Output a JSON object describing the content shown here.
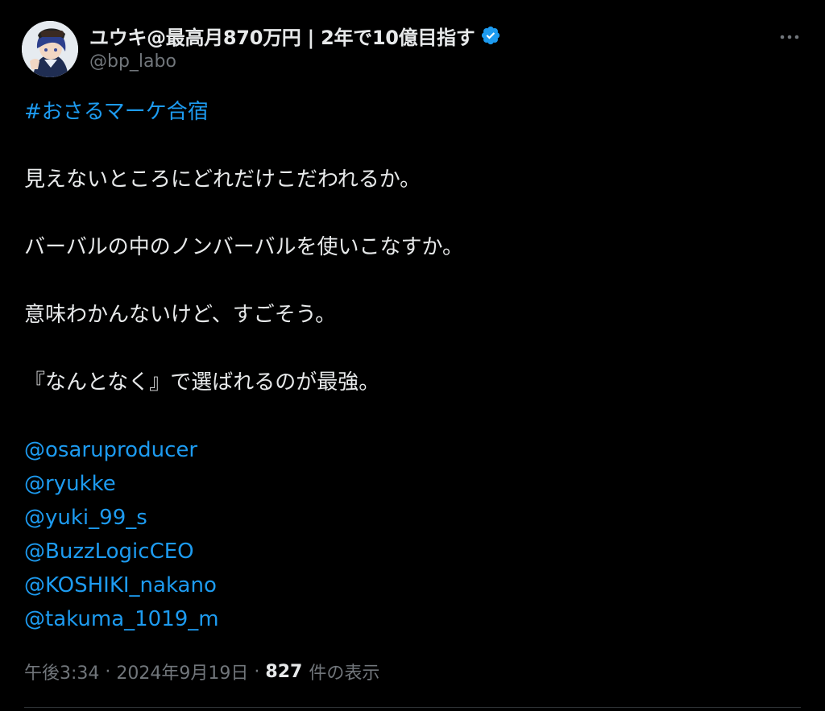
{
  "author": {
    "display_name": "ユウキ@最高月870万円 | 2年で10億目指す",
    "handle": "@bp_labo",
    "verified": true
  },
  "tweet": {
    "hashtag": "#おさるマーケ合宿",
    "lines": [
      "見えないところにどれだけこだわれるか。",
      "バーバルの中のノンバーバルを使いこなすか。",
      "意味わかんないけど、すごそう。",
      "『なんとなく』で選ばれるのが最強。"
    ],
    "mentions": [
      "@osaruproducer",
      "@ryukke",
      "@yuki_99_s",
      "@BuzzLogicCEO",
      "@KOSHIKI_nakano",
      "@takuma_1019_m"
    ]
  },
  "meta": {
    "time": "午後3:34",
    "separator": "·",
    "date": "2024年9月19日",
    "views_count": "827",
    "views_label": "件の表示"
  },
  "colors": {
    "background": "#000000",
    "text": "#e7e9ea",
    "link": "#1d9bf0",
    "secondary": "#71767b",
    "verified_badge": "#1d9bf0"
  },
  "icons": {
    "verified": "verified-badge-icon",
    "more": "more-options-icon"
  }
}
